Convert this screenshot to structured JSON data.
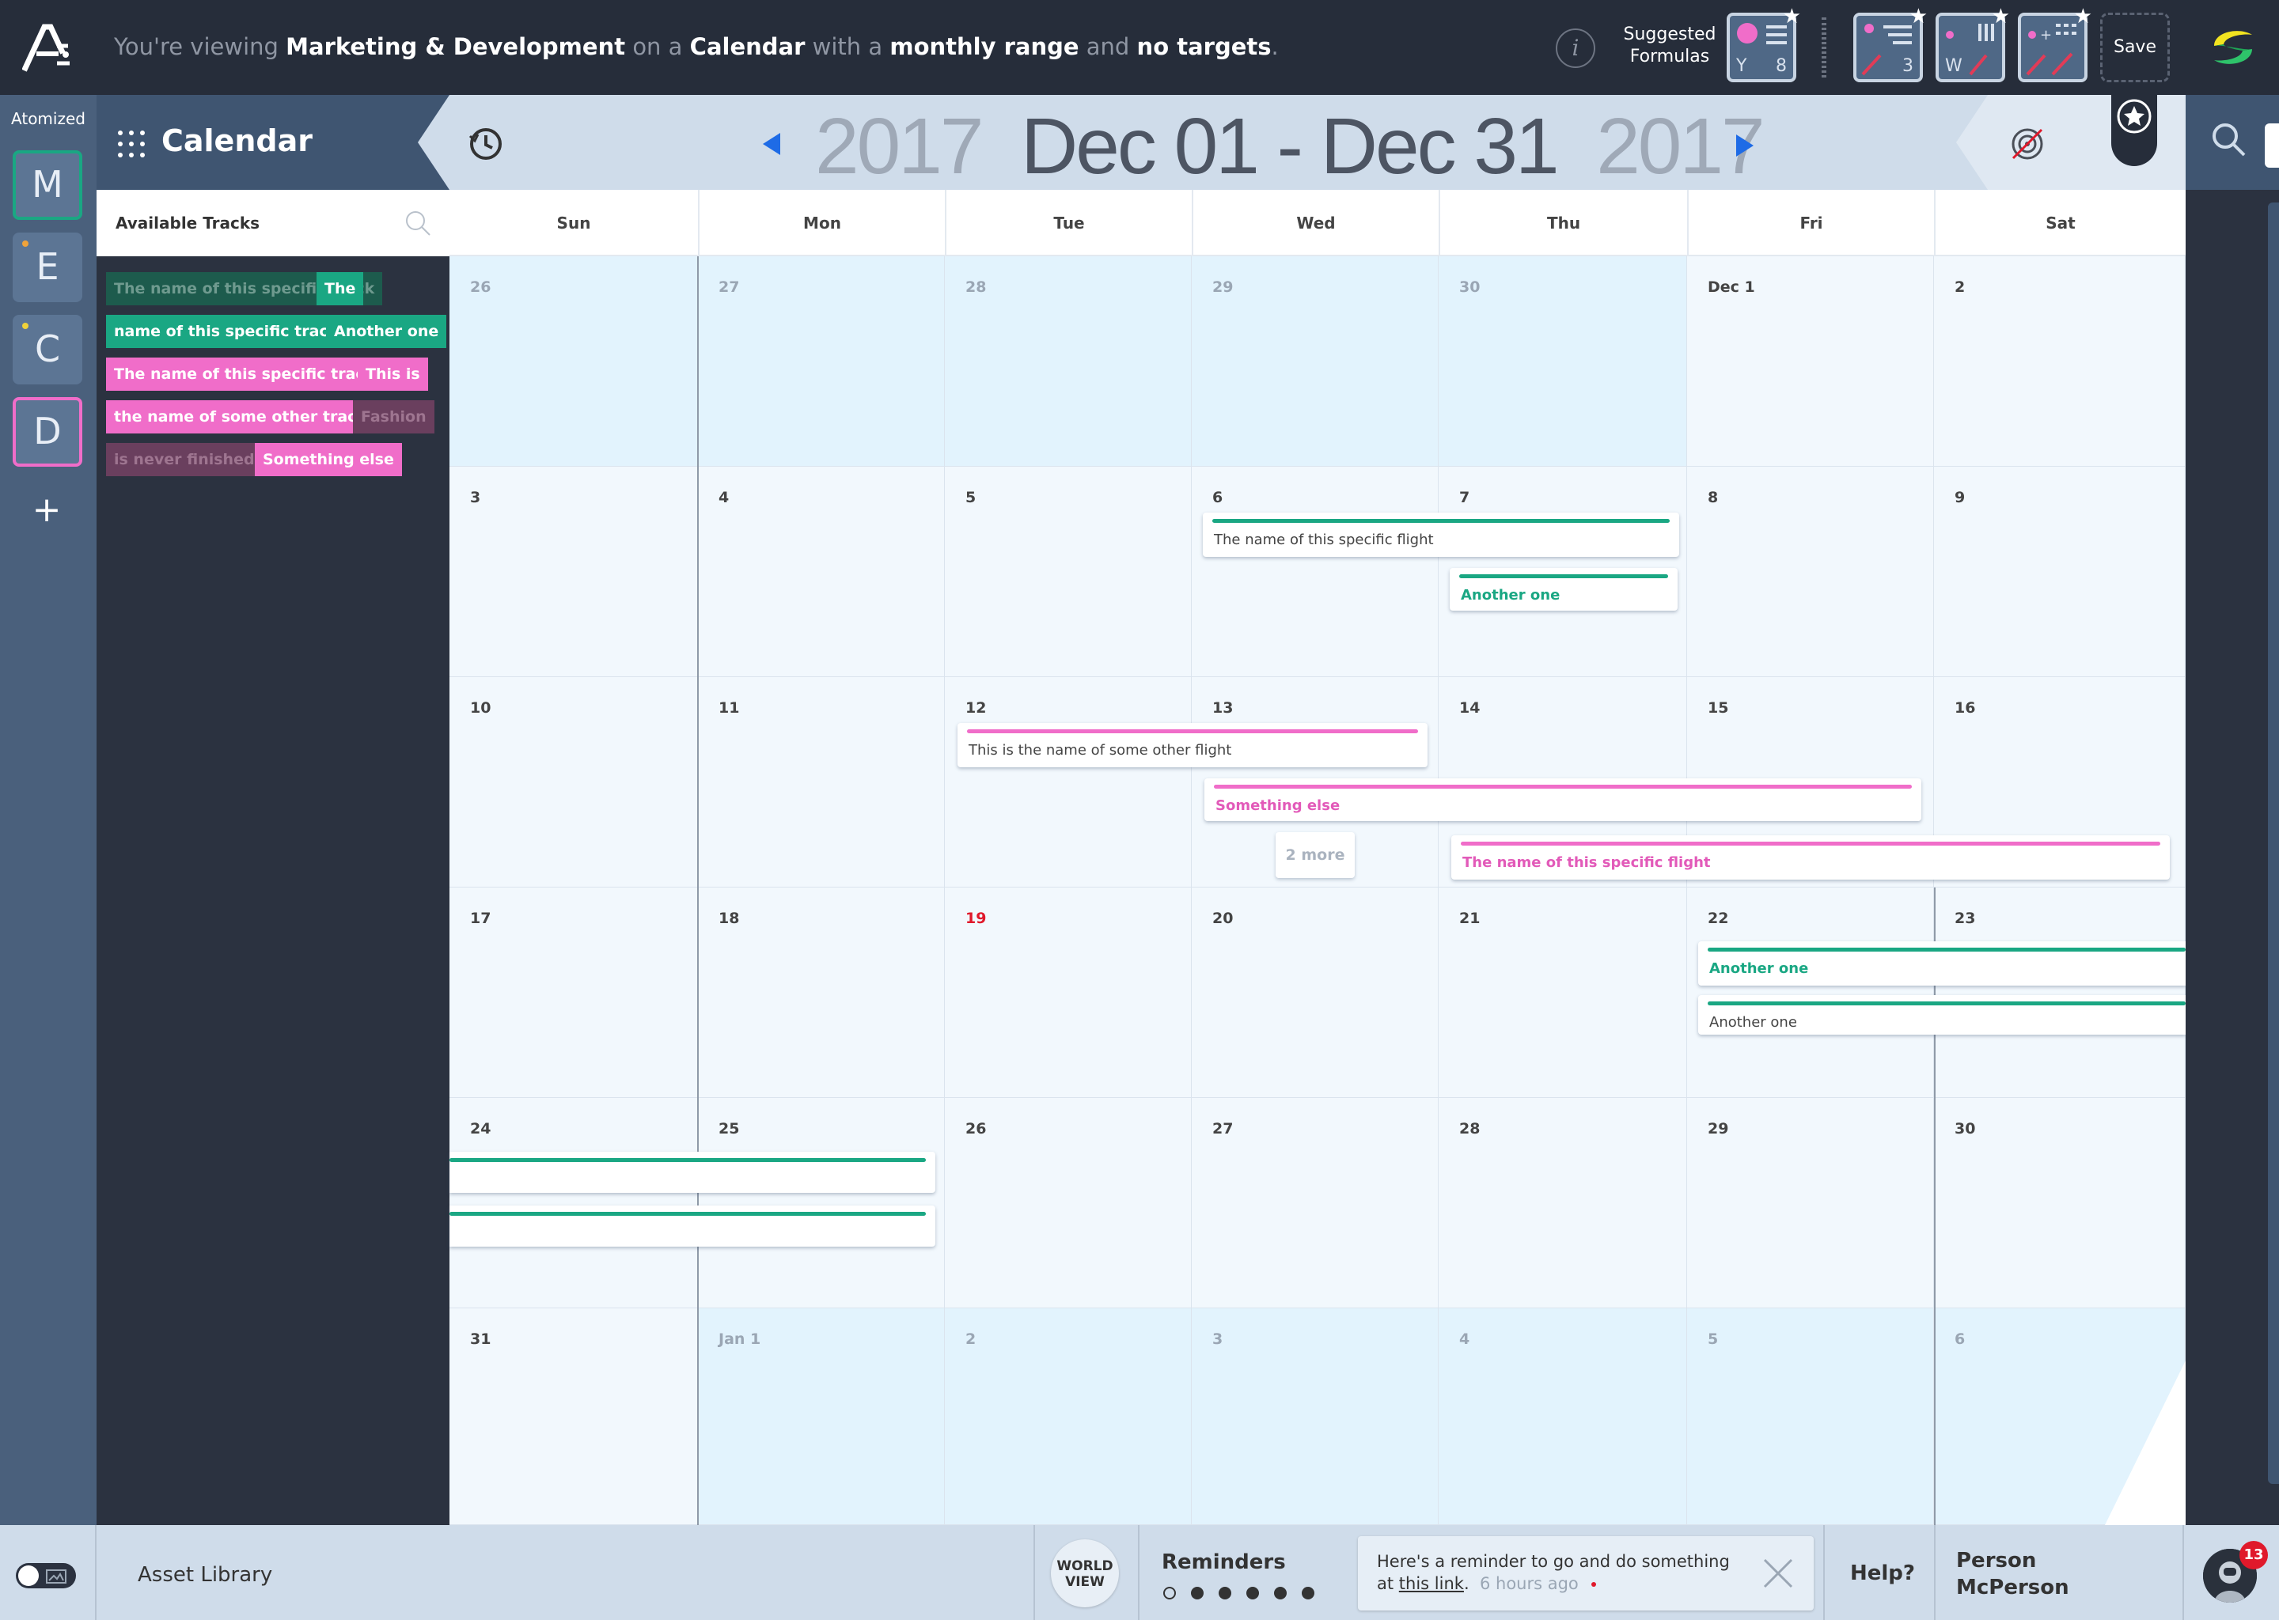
{
  "topbar": {
    "viewing_prefix": "You're viewing",
    "team": "Marketing & Development",
    "on_a": "on a",
    "view_type": "Calendar",
    "with_a": "with a",
    "range": "monthly range",
    "and": "and",
    "targets": "no targets",
    "period": ".",
    "info_glyph": "i",
    "suggested_line1": "Suggested",
    "suggested_line2": "Formulas",
    "formulas": [
      {
        "left": "Y",
        "right": "8",
        "icon": "pie-list-icon"
      },
      {
        "left": "",
        "right": "3",
        "icon": "trend-list-icon"
      },
      {
        "left": "W",
        "right": "",
        "icon": "bar-trend-icon"
      },
      {
        "left": "",
        "right": "",
        "icon": "grid-trend-icon"
      }
    ],
    "save_label": "Save"
  },
  "leftrail": {
    "title": "Atomized",
    "items": [
      {
        "letter": "M",
        "border": "#1aa783",
        "dot": ""
      },
      {
        "letter": "E",
        "border": "",
        "dot": "#f0a33a"
      },
      {
        "letter": "C",
        "border": "",
        "dot": "#f0d23a"
      },
      {
        "letter": "D",
        "border": "#f06dc9",
        "dot": ""
      }
    ],
    "add_label": "+"
  },
  "panel": {
    "title": "Calendar",
    "tracks_label": "Available Tracks",
    "chips": [
      {
        "text": "The name of this specific track",
        "style": "teal-dim"
      },
      {
        "text": "The",
        "style": "teal"
      },
      {
        "text": "name of this specific track",
        "style": "teal"
      },
      {
        "text": "Another one",
        "style": "teal"
      },
      {
        "text": "The name of this specific track",
        "style": "pink"
      },
      {
        "text": "This is",
        "style": "pink"
      },
      {
        "text": "the name of some other track",
        "style": "pink"
      },
      {
        "text": "Fashion",
        "style": "pink-dim"
      },
      {
        "text": "is never finished",
        "style": "pink-dim"
      },
      {
        "text": "Something else",
        "style": "pink"
      }
    ]
  },
  "date_header": {
    "year_start": "2017",
    "range": "Dec 01 - Dec 31",
    "year_end": "2017"
  },
  "calendar": {
    "days_of_week": [
      "Sun",
      "Mon",
      "Tue",
      "Wed",
      "Thu",
      "Fri",
      "Sat"
    ],
    "weeks": [
      [
        {
          "n": "26",
          "o": true
        },
        {
          "n": "27",
          "o": true
        },
        {
          "n": "28",
          "o": true
        },
        {
          "n": "29",
          "o": true
        },
        {
          "n": "30",
          "o": true
        },
        {
          "n": "Dec 1",
          "o": false
        },
        {
          "n": "2",
          "o": false
        }
      ],
      [
        {
          "n": "3",
          "o": false
        },
        {
          "n": "4",
          "o": false
        },
        {
          "n": "5",
          "o": false
        },
        {
          "n": "6",
          "o": false
        },
        {
          "n": "7",
          "o": false
        },
        {
          "n": "8",
          "o": false
        },
        {
          "n": "9",
          "o": false
        }
      ],
      [
        {
          "n": "10",
          "o": false
        },
        {
          "n": "11",
          "o": false
        },
        {
          "n": "12",
          "o": false
        },
        {
          "n": "13",
          "o": false
        },
        {
          "n": "14",
          "o": false
        },
        {
          "n": "15",
          "o": false
        },
        {
          "n": "16",
          "o": false
        }
      ],
      [
        {
          "n": "17",
          "o": false
        },
        {
          "n": "18",
          "o": false
        },
        {
          "n": "19",
          "o": false,
          "today": true
        },
        {
          "n": "20",
          "o": false
        },
        {
          "n": "21",
          "o": false
        },
        {
          "n": "22",
          "o": false
        },
        {
          "n": "23",
          "o": false
        }
      ],
      [
        {
          "n": "24",
          "o": false
        },
        {
          "n": "25",
          "o": false
        },
        {
          "n": "26",
          "o": false
        },
        {
          "n": "27",
          "o": false
        },
        {
          "n": "28",
          "o": false
        },
        {
          "n": "29",
          "o": false
        },
        {
          "n": "30",
          "o": false
        }
      ],
      [
        {
          "n": "31",
          "o": false
        },
        {
          "n": "Jan 1",
          "o": true
        },
        {
          "n": "2",
          "o": true
        },
        {
          "n": "3",
          "o": true
        },
        {
          "n": "4",
          "o": true
        },
        {
          "n": "5",
          "o": true
        },
        {
          "n": "6",
          "o": true
        }
      ]
    ],
    "flights": [
      {
        "label": "The name of this specific flight",
        "color": "teal",
        "label_style": "dark"
      },
      {
        "label": "Another one",
        "color": "teal",
        "label_style": "teal"
      },
      {
        "label": "This is the name of some other flight",
        "color": "pink",
        "label_style": "dark"
      },
      {
        "label": "Something else",
        "color": "pink",
        "label_style": "pink"
      },
      {
        "label": "The name of this specific flight",
        "color": "pink",
        "label_style": "pink"
      },
      {
        "label": "Another one",
        "color": "teal",
        "label_style": "teal"
      },
      {
        "label": "Another one",
        "color": "teal",
        "label_style": "dark"
      },
      {
        "label": "",
        "color": "teal",
        "label_style": "dark"
      },
      {
        "label": "",
        "color": "teal",
        "label_style": "dark"
      }
    ],
    "more_label": "2 more",
    "add_label": "+"
  },
  "bottombar": {
    "asset_library": "Asset Library",
    "world_view_line1": "WORLD",
    "world_view_line2": "VIEW",
    "reminders_title": "Reminders",
    "reminder_text": "Here's a reminder to go and do something",
    "reminder_at": "at",
    "reminder_link": "this link",
    "reminder_dot_char": ".",
    "reminder_time": "6 hours ago",
    "help": "Help?",
    "person_first": "Person",
    "person_last": "McPerson",
    "notification_count": "13"
  },
  "colors": {
    "teal": "#1aa783",
    "pink": "#f06dc9",
    "today": "#e0192b",
    "accent_blue": "#1e6be6"
  }
}
